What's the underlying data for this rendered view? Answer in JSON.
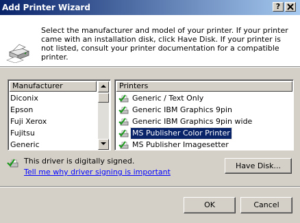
{
  "window": {
    "title": "Add Printer Wizard",
    "help_button": "?",
    "close_button": "X"
  },
  "header": {
    "instructions": "Select the manufacturer and model of your printer. If your printer came with an installation disk, click Have Disk. If your printer is not listed, consult your printer documentation for a compatible printer."
  },
  "manufacturer_list": {
    "header": "Manufacturer",
    "items": [
      "Diconix",
      "Epson",
      "Fuji Xerox",
      "Fujitsu",
      "Generic"
    ]
  },
  "printer_list": {
    "header": "Printers",
    "items": [
      "Generic / Text Only",
      "Generic IBM Graphics 9pin",
      "Generic IBM Graphics 9pin wide",
      "MS Publisher Color Printer",
      "MS Publisher Imagesetter"
    ],
    "selected": "MS Publisher Color Printer"
  },
  "signing": {
    "status": "This driver is digitally signed.",
    "link": "Tell me why driver signing is important"
  },
  "buttons": {
    "have_disk": "Have Disk...",
    "ok": "OK",
    "cancel": "Cancel"
  }
}
